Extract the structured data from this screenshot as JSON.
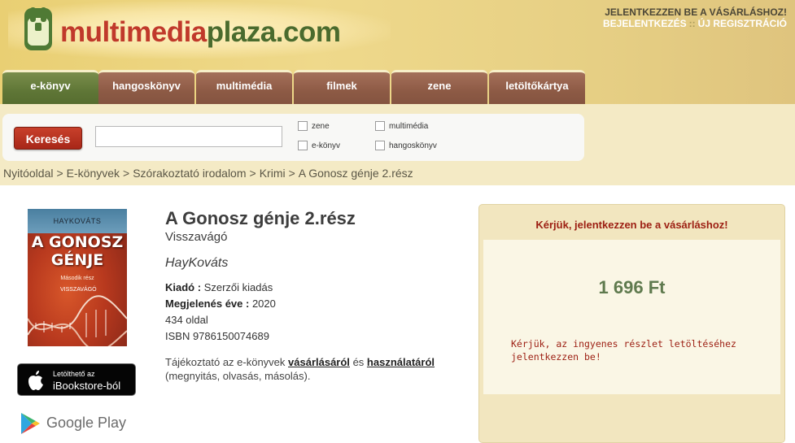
{
  "site": {
    "logo_part1": "multimedia",
    "logo_part2": "plaza.com"
  },
  "account": {
    "prompt": "JELENTKEZZEN BE A VÁSÁRLÁSHOZ!",
    "login": "BEJELENTKEZÉS",
    "separator": "::",
    "register": "ÚJ REGISZTRÁCIÓ"
  },
  "tabs": [
    {
      "label": "e-könyv",
      "active": true
    },
    {
      "label": "hangoskönyv"
    },
    {
      "label": "multimédia"
    },
    {
      "label": "filmek"
    },
    {
      "label": "zene"
    },
    {
      "label": "letöltőkártya"
    }
  ],
  "search": {
    "button": "Keresés",
    "input_value": "",
    "filters": [
      {
        "label": "zene",
        "checked": false
      },
      {
        "label": "multimédia",
        "checked": false
      },
      {
        "label": "e-könyv",
        "checked": false
      },
      {
        "label": "hangoskönyv",
        "checked": false
      }
    ]
  },
  "breadcrumb": [
    "Nyitóoldal",
    "E-könyvek",
    "Szórakoztató irodalom",
    "Krimi",
    "A Gonosz génje 2.rész"
  ],
  "breadcrumb_sep": ">",
  "cover": {
    "author": "HAYKOVÁTS",
    "title": "A GONOSZ GÉNJE",
    "subtitle": "Második rész",
    "series": "VISSZAVÁGÓ"
  },
  "badges": {
    "ibook_line1": "Letölthető az",
    "ibook_line2": "iBookstore-ból",
    "gplay": "Google Play"
  },
  "book": {
    "title": "A Gonosz génje 2.rész",
    "subtitle": "Visszavágó",
    "author": "HayKováts",
    "publisher_label": "Kiadó :",
    "publisher": "Szerzői kiadás",
    "year_label": "Megjelenés éve :",
    "year": "2020",
    "pages": "434 oldal",
    "isbn": "ISBN 9786150074689"
  },
  "guide": {
    "pre": "Tájékoztató az e-könyvek",
    "link1": "vásárlásáról",
    "mid": "és",
    "link2": "használatáról",
    "post": "(megnyitás, olvasás, másolás)."
  },
  "purchase": {
    "login_prompt": "Kérjük, jelentkezzen be a vásárláshoz!",
    "price": "1 696 Ft",
    "excerpt_note": "Kérjük, az ingyenes részlet letöltéséhez jelentkezzen be!"
  },
  "colors": {
    "header_gold": "#e9cf73",
    "tab_brown": "#8d5a45",
    "tab_active_green": "#5f7636",
    "search_button_red": "#b8321f",
    "price_green": "#5f7a4e",
    "alert_red": "#9c1e12"
  }
}
